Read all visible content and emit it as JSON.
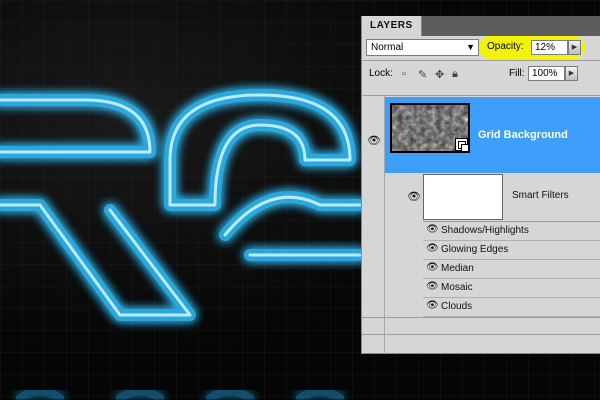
{
  "canvas": {
    "glow_color": "#33c2ff",
    "core_color": "#b9ecff",
    "background_color": "#050505"
  },
  "layers_panel": {
    "tab_label": "LAYERS",
    "blend_mode": "Normal",
    "opacity_label": "Opacity:",
    "opacity_value": "12%",
    "opacity_highlight_color": "#f3f30a",
    "lock_label": "Lock:",
    "fill_label": "Fill:",
    "fill_value": "100%",
    "selected_color": "#3d9ff9",
    "layer": {
      "name": "Grid Background",
      "visible": true,
      "smart_object": true
    },
    "smart_filters": {
      "label": "Smart Filters",
      "filters": [
        {
          "name": "Shadows/Highlights"
        },
        {
          "name": "Glowing Edges"
        },
        {
          "name": "Median"
        },
        {
          "name": "Mosaic"
        },
        {
          "name": "Clouds"
        }
      ]
    }
  }
}
